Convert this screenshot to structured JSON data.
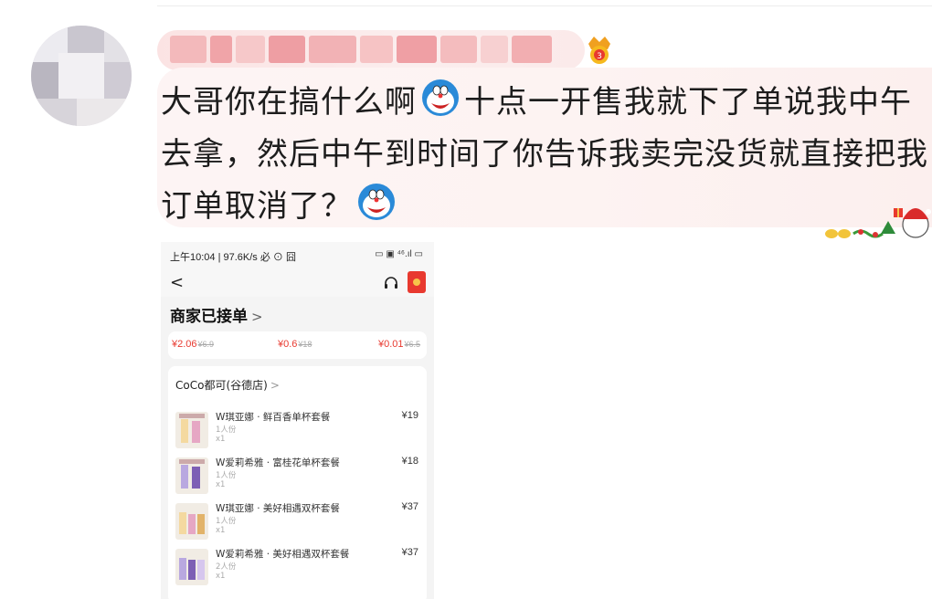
{
  "user": {
    "name": "",
    "avatar_color": "#d9d7de",
    "vip_badge_icon": "crown-medal-icon"
  },
  "comment": {
    "text_part1": "大哥你在搞什么啊",
    "text_part2": "十点一开售我就下了单说我中午去拿，然后中午到时间了你告诉我卖完没货就直接把我订单取消了？",
    "emoji_icon": "doraemon-face-icon"
  },
  "decoration_icon": "christmas-sticker-icon",
  "phone": {
    "status_time": "上午10:04 | 97.6K/s 必 ⊙ 囧",
    "status_right": "▭ ▣ ⁴⁶.ıl ▭",
    "back_label": "<",
    "order_status": "商家已接单",
    "order_status_chevron": ">",
    "prices": [
      {
        "price": "¥2.06",
        "original": "¥6.9"
      },
      {
        "price": "¥0.6",
        "original": "¥18"
      },
      {
        "price": "¥0.01",
        "original": "¥6.5"
      }
    ],
    "shop_name": "CoCo都可(谷德店)",
    "shop_chevron": ">",
    "items": [
      {
        "title": "W琪亚娜 · 鲜百香单杯套餐",
        "serving": "1人份",
        "qty": "x1",
        "price": "¥19"
      },
      {
        "title": "W爱莉希雅 · 富桂花单杯套餐",
        "serving": "1人份",
        "qty": "x1",
        "price": "¥18"
      },
      {
        "title": "W琪亚娜 · 美好相遇双杯套餐",
        "serving": "1人份",
        "qty": "x1",
        "price": "¥37"
      },
      {
        "title": "W爱莉希雅 · 美好相遇双杯套餐",
        "serving": "2人份",
        "qty": "x1",
        "price": "¥37"
      }
    ],
    "accent_color": "#e8392f"
  }
}
